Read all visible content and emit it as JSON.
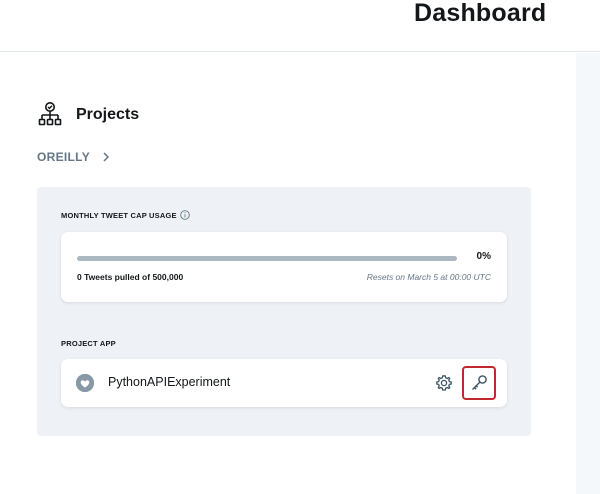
{
  "header": {
    "title": "Dashboard"
  },
  "projects": {
    "title": "Projects",
    "icon": "org-chart-icon",
    "breadcrumb": {
      "label": "OREILLY",
      "icon": "chevron-right-icon"
    }
  },
  "tweet_cap": {
    "label": "MONTHLY TWEET CAP USAGE",
    "info_icon": "info-icon",
    "percent_text": "0%",
    "usage_fraction": 0,
    "pulled_count": "0",
    "pulled_text": "Tweets pulled of",
    "cap": "500,000",
    "resets_text": "Resets on March 5 at 00:00 UTC"
  },
  "project_app": {
    "label": "PROJECT APP",
    "name": "PythonAPIExperiment",
    "avatar_icon": "app-avatar-icon",
    "settings_icon": "gear-icon",
    "keys_icon": "key-icon"
  },
  "colors": {
    "accent": "#1da1f2",
    "panel": "#eef1f6",
    "highlight_border": "#c0282d",
    "muted_text": "#657786"
  }
}
